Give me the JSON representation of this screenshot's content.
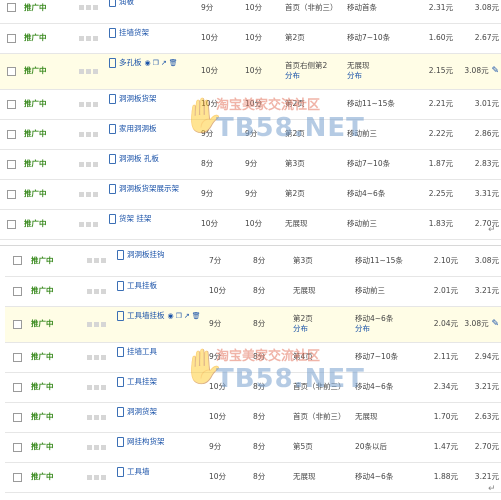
{
  "tables": [
    {
      "rows": [
        {
          "status": "推广中",
          "title": "润板",
          "price": "9分",
          "bid": "10分",
          "rank": "首页（非前三）",
          "mobile": "移动首条",
          "cost": "2.31元",
          "avg": "3.08元",
          "hl": false,
          "acts": false
        },
        {
          "status": "推广中",
          "title": "挂墙货架",
          "price": "10分",
          "bid": "10分",
          "rank": "第2页",
          "mobile": "移动7~10条",
          "cost": "1.60元",
          "avg": "2.67元",
          "hl": false,
          "acts": false
        },
        {
          "status": "推广中",
          "title": "多孔板",
          "price": "10分",
          "bid": "10分",
          "rank": "首页右侧第2",
          "mobile": "无展现",
          "rank2": "分布",
          "mobile2": "分布",
          "cost": "2.15元",
          "avg": "3.08元",
          "hl": true,
          "acts": true
        },
        {
          "status": "推广中",
          "title": "洞洞板货架",
          "price": "10分",
          "bid": "10分",
          "rank": "第2页",
          "mobile": "移动11~15条",
          "cost": "2.21元",
          "avg": "3.01元",
          "hl": false,
          "acts": false
        },
        {
          "status": "推广中",
          "title": "家用洞洞板",
          "price": "9分",
          "bid": "9分",
          "rank": "第2页",
          "mobile": "移动前三",
          "cost": "2.22元",
          "avg": "2.86元",
          "hl": false,
          "acts": false
        },
        {
          "status": "推广中",
          "title": "洞洞板 孔板",
          "price": "8分",
          "bid": "9分",
          "rank": "第3页",
          "mobile": "移动7~10条",
          "cost": "1.87元",
          "avg": "2.83元",
          "hl": false,
          "acts": false
        },
        {
          "status": "推广中",
          "title": "洞洞板货架展示架",
          "price": "9分",
          "bid": "9分",
          "rank": "第2页",
          "mobile": "移动4~6条",
          "cost": "2.25元",
          "avg": "3.31元",
          "hl": false,
          "acts": false
        },
        {
          "status": "推广中",
          "title": "货架 挂架",
          "price": "10分",
          "bid": "10分",
          "rank": "无展现",
          "mobile": "移动前三",
          "cost": "1.83元",
          "avg": "2.70元",
          "hl": false,
          "acts": false
        }
      ]
    },
    {
      "rows": [
        {
          "status": "推广中",
          "title": "洞洞板挂钩",
          "price": "7分",
          "bid": "8分",
          "rank": "第3页",
          "mobile": "移动11~15条",
          "cost": "2.10元",
          "avg": "3.08元",
          "hl": false,
          "acts": false
        },
        {
          "status": "推广中",
          "title": "工具挂板",
          "price": "10分",
          "bid": "8分",
          "rank": "无展现",
          "mobile": "移动前三",
          "cost": "2.01元",
          "avg": "3.21元",
          "hl": false,
          "acts": false
        },
        {
          "status": "推广中",
          "title": "工具墙挂板",
          "price": "9分",
          "bid": "8分",
          "rank": "第2页",
          "mobile": "移动4~6条",
          "rank2": "分布",
          "mobile2": "分布",
          "cost": "2.04元",
          "avg": "3.08元",
          "hl": true,
          "acts": true
        },
        {
          "status": "推广中",
          "title": "挂墙工具",
          "price": "9分",
          "bid": "8分",
          "rank": "第4页",
          "mobile": "移动7~10条",
          "cost": "2.11元",
          "avg": "2.94元",
          "hl": false,
          "acts": false
        },
        {
          "status": "推广中",
          "title": "工具挂架",
          "price": "10分",
          "bid": "8分",
          "rank": "首页（非前三）",
          "mobile": "移动4~6条",
          "cost": "2.34元",
          "avg": "3.21元",
          "hl": false,
          "acts": false
        },
        {
          "status": "推广中",
          "title": "洞洞货架",
          "price": "10分",
          "bid": "8分",
          "rank": "首页（非前三）",
          "mobile": "无展现",
          "cost": "1.70元",
          "avg": "2.63元",
          "hl": false,
          "acts": false
        },
        {
          "status": "推广中",
          "title": "网挂构货架",
          "price": "9分",
          "bid": "8分",
          "rank": "第5页",
          "mobile": "20条以后",
          "cost": "1.47元",
          "avg": "2.70元",
          "hl": false,
          "acts": false
        },
        {
          "status": "推广中",
          "title": "工具墙",
          "price": "10分",
          "bid": "8分",
          "rank": "无展现",
          "mobile": "移动4~6条",
          "cost": "1.88元",
          "avg": "3.21元",
          "hl": false,
          "acts": false
        }
      ]
    }
  ],
  "watermark": {
    "cn": "淘宝美家交流社区",
    "en": "TB58.NET"
  },
  "icons": {
    "checkbox": "checkbox-icon",
    "phone": "phone-icon",
    "edit": "pencil-icon",
    "actions": [
      "globe-icon",
      "copy-icon",
      "chart-icon",
      "trash-icon"
    ]
  }
}
